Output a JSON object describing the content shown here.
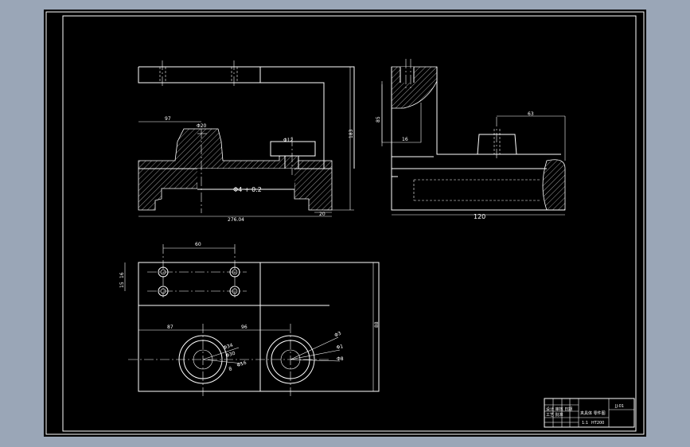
{
  "drawing": {
    "dimensions": {
      "overall_length": "276.04",
      "bore_tolerance": "Φ4 + 0.2",
      "right_edge": "20",
      "side_width": "120",
      "top_left_width": "97",
      "height_main": "183",
      "side_height": "85",
      "side_small": "16",
      "side_top": "63",
      "plan_top": "60",
      "plan_left_a": "16",
      "plan_left_b": "15",
      "plan_center_left": "87",
      "plan_center_right": "96",
      "hole_d34": "Φ34",
      "hole_d30": "Φ30",
      "hole_d16": "Φ16",
      "hole_d8": "8",
      "hole_r_a": "Φ3",
      "hole_r_b": "Φ1",
      "hole_r_c": "Φ8",
      "plan_right_height": "88",
      "boss_label": "Φ20",
      "pin_label": "Φ12"
    },
    "title_block": {
      "row1": "设计 审核 日期",
      "row2": "工艺 批准",
      "name": "夹具体 零件图",
      "code": "JJ-01",
      "material": "HT200",
      "scale": "1:1"
    }
  }
}
